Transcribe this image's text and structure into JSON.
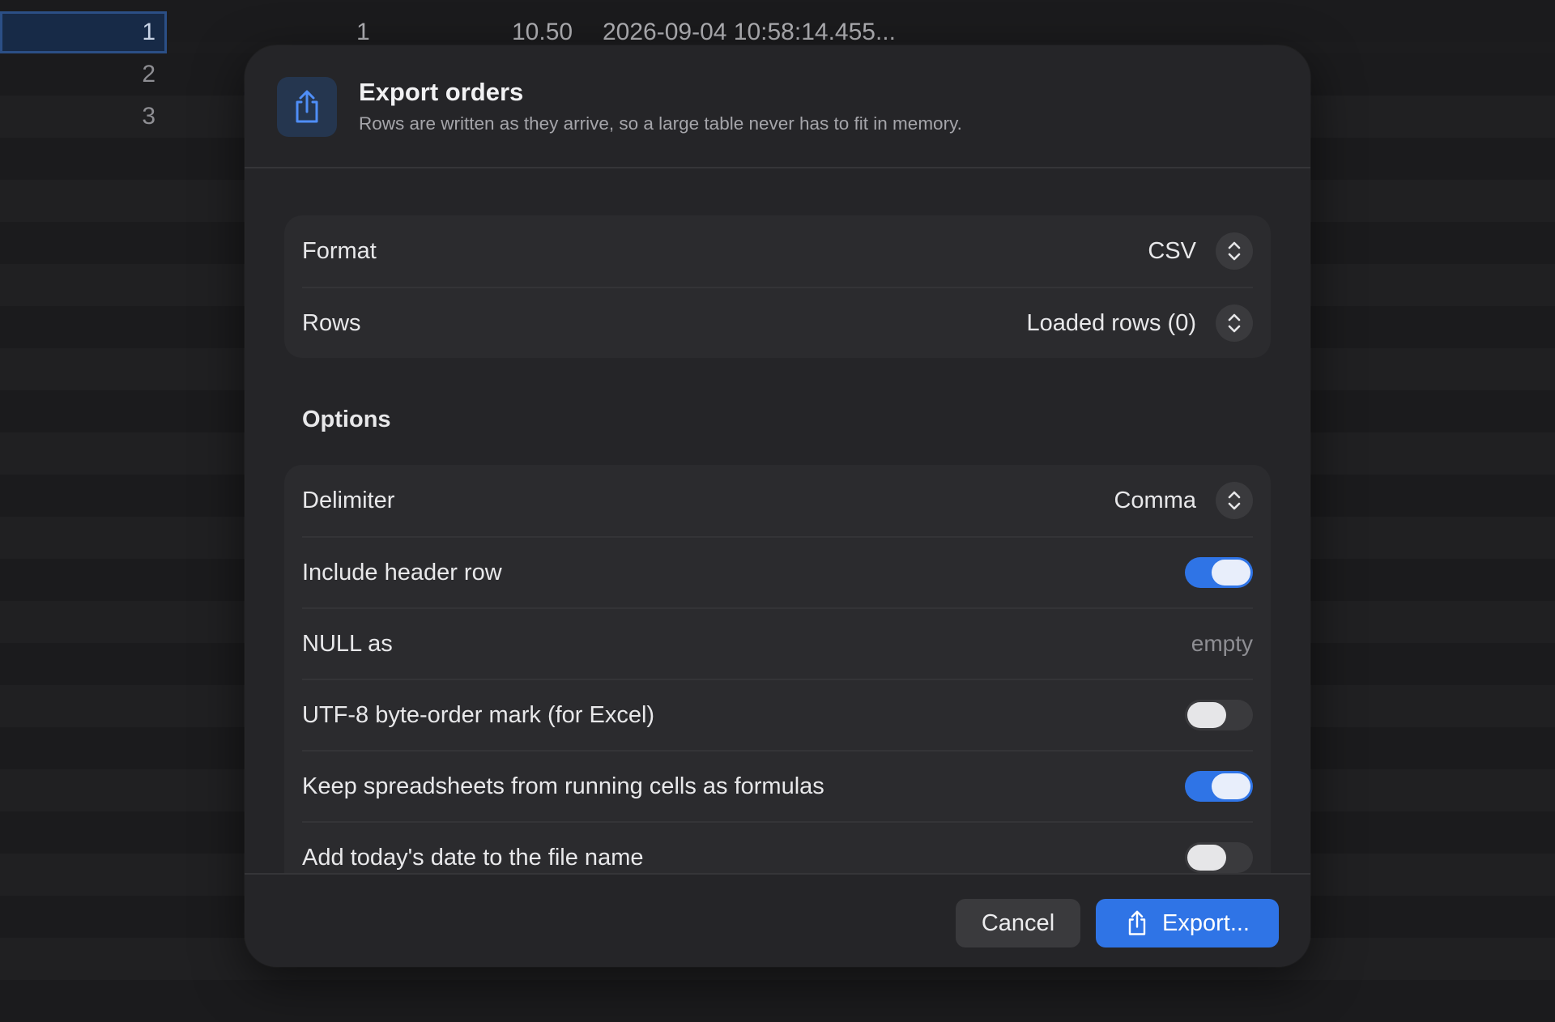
{
  "background_table": {
    "row_numbers": [
      "1",
      "2",
      "3"
    ],
    "row1_cells": [
      "1",
      "10.50",
      "2026-09-04 10:58:14.455..."
    ]
  },
  "dialog": {
    "title": "Export orders",
    "subtitle": "Rows are written as they arrive, so a large table never has to fit in memory.",
    "header_icon": "share-icon",
    "format": {
      "label": "Format",
      "value": "CSV"
    },
    "rows": {
      "label": "Rows",
      "value": "Loaded rows (0)"
    },
    "options_title": "Options",
    "options": {
      "delimiter": {
        "label": "Delimiter",
        "value": "Comma"
      },
      "include_header": {
        "label": "Include header row",
        "on": true
      },
      "null_as": {
        "label": "NULL as",
        "value": "empty"
      },
      "utf8_bom": {
        "label": "UTF-8 byte-order mark (for Excel)",
        "on": false
      },
      "keep_formulas": {
        "label": "Keep spreadsheets from running cells as formulas",
        "on": true
      },
      "add_date": {
        "label": "Add today's date to the file name",
        "on": false
      }
    },
    "cancel_label": "Cancel",
    "export_label": "Export..."
  },
  "colors": {
    "accent": "#2f74e6",
    "dialog_bg": "#252528",
    "section_bg": "#2b2b2e"
  }
}
